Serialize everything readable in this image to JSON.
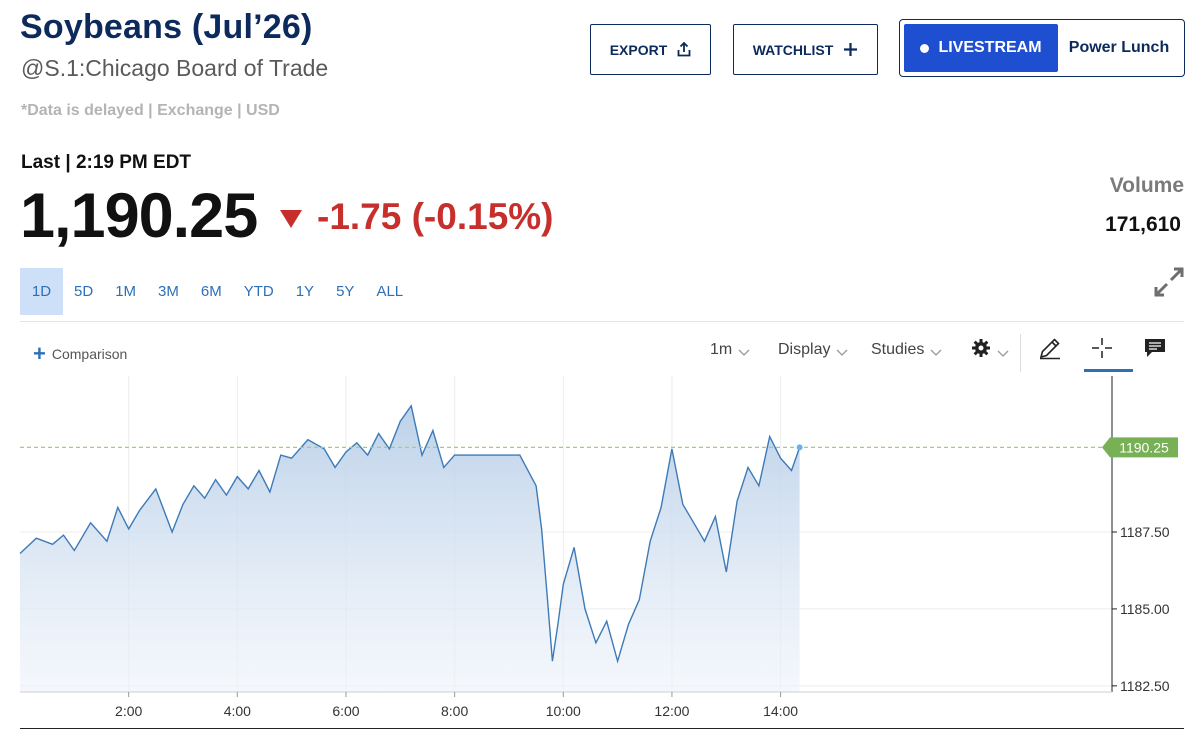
{
  "header": {
    "title": "Soybeans (Jul’26)",
    "subtitle": "@S.1:Chicago Board of Trade",
    "delayed_note": "*Data is delayed | Exchange | USD"
  },
  "actions": {
    "export_label": "EXPORT",
    "watchlist_label": "WATCHLIST",
    "livestream_label": "LIVESTREAM",
    "show_label": "Power Lunch"
  },
  "quote": {
    "last_time": "Last | 2:19 PM EDT",
    "price": "1,190.25",
    "change": "-1.75 (-0.15%)",
    "volume_label": "Volume",
    "volume_value": "171,610"
  },
  "ranges": [
    "1D",
    "5D",
    "1M",
    "3M",
    "6M",
    "YTD",
    "1Y",
    "5Y",
    "ALL"
  ],
  "active_range": "1D",
  "toolbar": {
    "comparison_label": "Comparison",
    "interval_label": "1m",
    "display_label": "Display",
    "studies_label": "Studies"
  },
  "icons": [
    "share-icon",
    "plus-icon",
    "dot-icon",
    "down-triangle-icon",
    "expand-icon",
    "chevron-down-icon",
    "gear-icon",
    "pencil-icon",
    "crosshair-icon",
    "comment-icon"
  ],
  "colors": {
    "brand_navy": "#0d2a5c",
    "accent_blue": "#1f4fd1",
    "link_blue": "#2e6fb7",
    "negative_red": "#c62f2b",
    "line_blue": "#3d7ab8",
    "last_price_green": "#77b055"
  },
  "chart_data": {
    "type": "area",
    "x_tick_labels": [
      "2:00",
      "4:00",
      "6:00",
      "8:00",
      "10:00",
      "12:00",
      "14:00"
    ],
    "x_tick_hours": [
      2,
      4,
      6,
      8,
      10,
      12,
      14
    ],
    "y_tick_labels": [
      "1187.50",
      "1185.00",
      "1182.50"
    ],
    "y_tick_values": [
      1187.5,
      1185.0,
      1182.5
    ],
    "ylim": [
      1182.3,
      1192.7
    ],
    "xlim": [
      0,
      20.1
    ],
    "last_price_label": "1190.25",
    "last_price": 1190.25,
    "x": [
      0.0,
      0.3,
      0.6,
      0.8,
      1.0,
      1.3,
      1.6,
      1.8,
      2.0,
      2.2,
      2.5,
      2.8,
      3.0,
      3.2,
      3.4,
      3.6,
      3.8,
      4.0,
      4.2,
      4.4,
      4.6,
      4.8,
      5.0,
      5.3,
      5.6,
      5.8,
      6.0,
      6.2,
      6.4,
      6.6,
      6.8,
      7.0,
      7.2,
      7.4,
      7.6,
      7.8,
      8.0,
      8.3,
      8.6,
      8.9,
      9.2,
      9.5,
      9.6,
      9.7,
      9.8,
      9.9,
      10.0,
      10.2,
      10.4,
      10.6,
      10.8,
      11.0,
      11.2,
      11.4,
      11.6,
      11.8,
      12.0,
      12.2,
      12.4,
      12.6,
      12.8,
      13.0,
      13.2,
      13.4,
      13.6,
      13.8,
      14.0,
      14.2,
      14.35
    ],
    "y": [
      1186.8,
      1187.3,
      1187.1,
      1187.4,
      1186.9,
      1187.8,
      1187.2,
      1188.3,
      1187.6,
      1188.2,
      1188.9,
      1187.5,
      1188.4,
      1189.0,
      1188.6,
      1189.2,
      1188.7,
      1189.3,
      1188.9,
      1189.5,
      1188.8,
      1190.0,
      1189.9,
      1190.5,
      1190.2,
      1189.6,
      1190.1,
      1190.4,
      1190.0,
      1190.7,
      1190.2,
      1191.1,
      1191.6,
      1190.0,
      1190.8,
      1189.6,
      1190.0,
      1190.0,
      1190.0,
      1190.0,
      1190.0,
      1189.0,
      1187.6,
      1185.5,
      1183.3,
      1184.5,
      1185.8,
      1187.0,
      1185.0,
      1183.9,
      1184.6,
      1183.3,
      1184.5,
      1185.3,
      1187.2,
      1188.3,
      1190.2,
      1188.4,
      1187.8,
      1187.2,
      1188.0,
      1186.2,
      1188.5,
      1189.6,
      1189.0,
      1190.6,
      1189.9,
      1189.5,
      1190.25
    ]
  }
}
